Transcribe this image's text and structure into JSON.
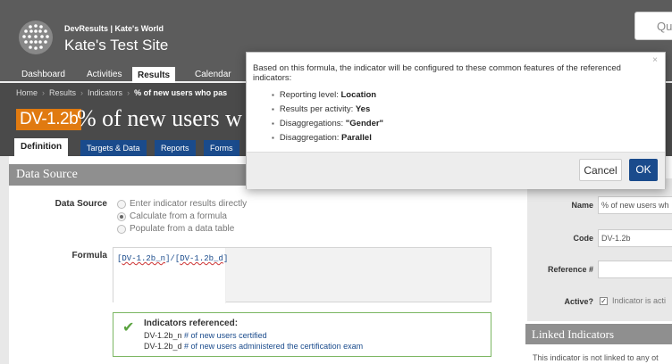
{
  "header": {
    "org_name": "DevResults | Kate's World",
    "site_name": "Kate's Test Site",
    "search_placeholder": "Quick"
  },
  "nav": {
    "items": [
      "Dashboard",
      "Activities",
      "Results",
      "Calendar"
    ],
    "active": "Results"
  },
  "breadcrumb": {
    "items": [
      "Home",
      "Results",
      "Indicators"
    ],
    "current": "% of new users who pas"
  },
  "indicator": {
    "code": "DV-1.2b",
    "title": "% of new users w"
  },
  "tabs": [
    "Definition",
    "Targets & Data",
    "Reports",
    "Forms"
  ],
  "data_source": {
    "panel_title": "Data Source",
    "label": "Data Source",
    "options": [
      "Enter indicator results directly",
      "Calculate from a formula",
      "Populate from a data table"
    ],
    "selected_index": 1,
    "formula_label": "Formula",
    "formula_parts": [
      "[",
      "DV-1.2b_n",
      "]/[",
      "DV-1.2b_d",
      "]"
    ]
  },
  "referenced": {
    "title": "Indicators referenced:",
    "items": [
      {
        "code": "DV-1.2b_n",
        "name": "# of new users certified"
      },
      {
        "code": "DV-1.2b_d",
        "name": "# of new users administered the certification exam"
      }
    ]
  },
  "right": {
    "name_label": "Name",
    "name_value": "% of new users wh",
    "code_label": "Code",
    "code_value": "DV-1.2b",
    "ref_label": "Reference #",
    "ref_value": "",
    "active_label": "Active?",
    "active_text": "Indicator is acti",
    "linked_title": "Linked Indicators",
    "linked_text": "This indicator is not linked to any ot"
  },
  "modal": {
    "close": "×",
    "message": "Based on this formula, the indicator will be configured to these common features of the referenced indicators:",
    "features": [
      {
        "label": "Reporting level:",
        "value": "Location"
      },
      {
        "label": "Results per activity:",
        "value": "Yes"
      },
      {
        "label": "Disaggregations:",
        "value": "\"Gender\""
      },
      {
        "label": "Disaggregation:",
        "value": "Parallel"
      }
    ],
    "cancel_label": "Cancel",
    "ok_label": "OK"
  },
  "colors": {
    "header_bg": "#5c5c5c",
    "badge": "#e07a10",
    "tab_blue": "#1a4b8c",
    "ok_blue": "#1a4b8c",
    "success_green": "#5aa33f"
  }
}
